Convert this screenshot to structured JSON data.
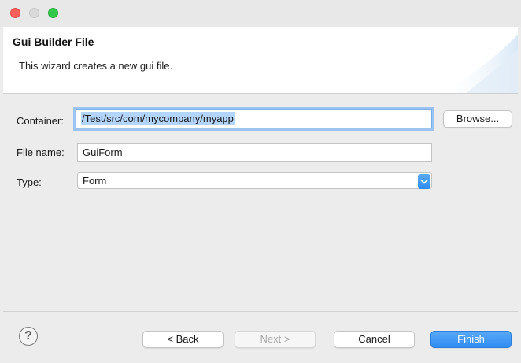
{
  "header": {
    "title": "Gui Builder File",
    "description": "This wizard creates a new gui file."
  },
  "form": {
    "container_label": "Container:",
    "container_value": "/Test/src/com/mycompany/myapp",
    "browse_label": "Browse...",
    "filename_label": "File name:",
    "filename_value": "GuiForm",
    "type_label": "Type:",
    "type_value": "Form"
  },
  "footer": {
    "help_symbol": "?",
    "back_label": "< Back",
    "next_label": "Next >",
    "cancel_label": "Cancel",
    "finish_label": "Finish"
  },
  "colors": {
    "accent": "#2f8cf2",
    "close": "#fc605b",
    "maximize": "#34c84a"
  }
}
